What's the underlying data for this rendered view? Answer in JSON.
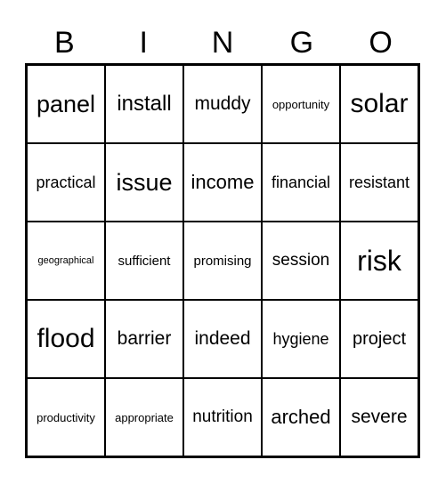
{
  "header": [
    "B",
    "I",
    "N",
    "G",
    "O"
  ],
  "cells": [
    [
      "panel",
      "install",
      "muddy",
      "opportunity",
      "solar"
    ],
    [
      "practical",
      "issue",
      "income",
      "financial",
      "resistant"
    ],
    [
      "geographical",
      "sufficient",
      "promising",
      "session",
      "risk"
    ],
    [
      "flood",
      "barrier",
      "indeed",
      "hygiene",
      "project"
    ],
    [
      "productivity",
      "appropriate",
      "nutrition",
      "arched",
      "severe"
    ]
  ]
}
